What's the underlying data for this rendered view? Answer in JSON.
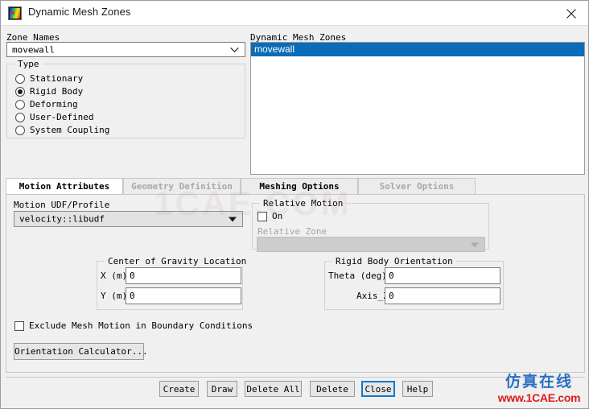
{
  "window": {
    "title": "Dynamic Mesh Zones",
    "icon": "fluent-contour-icon",
    "close_icon": "close-icon"
  },
  "zone_names": {
    "label": "Zone Names",
    "value": "movewall",
    "chevron_icon": "chevron-down-icon"
  },
  "type_group": {
    "title": "Type",
    "options": [
      {
        "label": "Stationary",
        "selected": false
      },
      {
        "label": "Rigid Body",
        "selected": true
      },
      {
        "label": "Deforming",
        "selected": false
      },
      {
        "label": "User-Defined",
        "selected": false
      },
      {
        "label": "System Coupling",
        "selected": false
      }
    ]
  },
  "zone_list": {
    "label": "Dynamic Mesh Zones",
    "items": [
      {
        "label": "movewall",
        "selected": true
      }
    ]
  },
  "tabs": [
    {
      "label": "Motion Attributes",
      "state": "active"
    },
    {
      "label": "Geometry Definition",
      "state": "disabled"
    },
    {
      "label": "Meshing Options",
      "state": "enabled"
    },
    {
      "label": "Solver Options",
      "state": "disabled"
    }
  ],
  "motion_udf": {
    "label": "Motion UDF/Profile",
    "value": "velocity::libudf",
    "chevron_icon": "chevron-down-icon"
  },
  "relative_motion": {
    "title": "Relative Motion",
    "on_label": "On",
    "on_checked": false,
    "zone_label": "Relative Zone",
    "zone_value": "",
    "zone_disabled": true,
    "chevron_icon": "chevron-down-icon"
  },
  "cog_group": {
    "title": "Center of Gravity Location",
    "fields": [
      {
        "label": "X (m)",
        "value": "0"
      },
      {
        "label": "Y (m)",
        "value": "0"
      }
    ]
  },
  "orientation_group": {
    "title": "Rigid Body Orientation",
    "fields": [
      {
        "label": "Theta (deg)",
        "value": "0"
      },
      {
        "label": "Axis_Z",
        "value": "0"
      }
    ]
  },
  "exclude_mesh_motion": {
    "label": "Exclude Mesh Motion in Boundary Conditions",
    "checked": false
  },
  "orientation_calculator": {
    "label": "Orientation Calculator..."
  },
  "footer_buttons": [
    {
      "label": "Create",
      "focused": false
    },
    {
      "label": "Draw",
      "focused": false
    },
    {
      "label": "Delete All",
      "focused": false
    },
    {
      "label": "Delete",
      "focused": false
    },
    {
      "label": "Close",
      "focused": true
    },
    {
      "label": "Help",
      "focused": false
    }
  ],
  "watermarks": {
    "center": "1CAE.COM",
    "logo_cn": "仿真在线",
    "logo_en": "www.1CAE.com"
  },
  "colors": {
    "selection_blue": "#0b6cb8",
    "focus_blue": "#0b79d0",
    "dialog_bg": "#f0f0f0",
    "disabled_text": "#a3a3a3"
  }
}
